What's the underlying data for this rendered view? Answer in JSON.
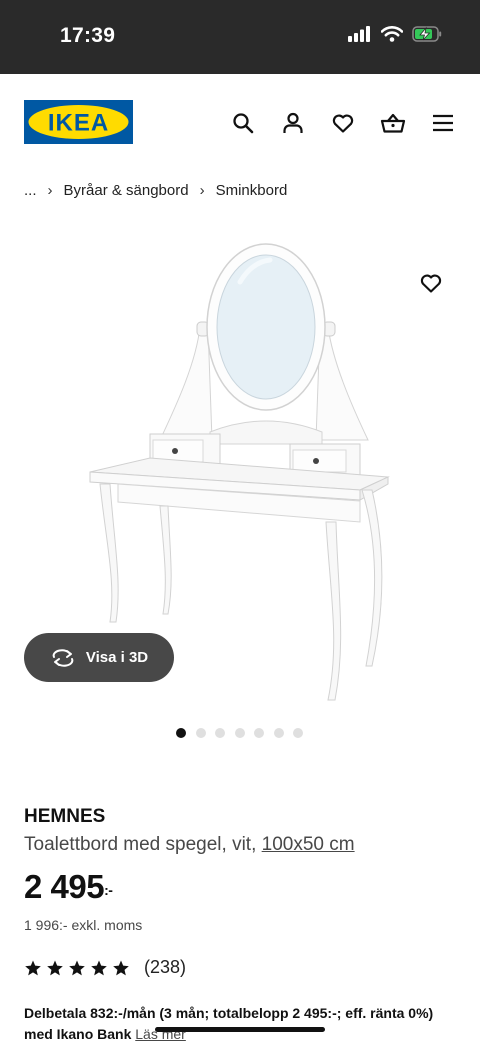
{
  "status": {
    "time": "17:39"
  },
  "header": {
    "logo_text": "IKEA",
    "logo_blue": "#0058a3",
    "logo_yellow": "#ffdb00"
  },
  "breadcrumb": {
    "items": [
      "...",
      "Byråar & sängbord",
      "Sminkbord"
    ]
  },
  "gallery": {
    "view3d_label": "Visa i 3D",
    "total_images": 7,
    "active_index": 0
  },
  "product": {
    "brand": "HEMNES",
    "description": "Toalettbord med spegel, vit,",
    "size": "100x50 cm",
    "price": "2 495",
    "price_suffix": ":-",
    "price_exvat": "1 996:- exkl. moms",
    "rating_stars": 5,
    "rating_count": "(238)",
    "finance_text": "Delbetala 832:-/mån (3 mån; totalbelopp 2 495:-; eff. ränta 0%) med Ikano Bank",
    "finance_link": "Läs mer"
  }
}
